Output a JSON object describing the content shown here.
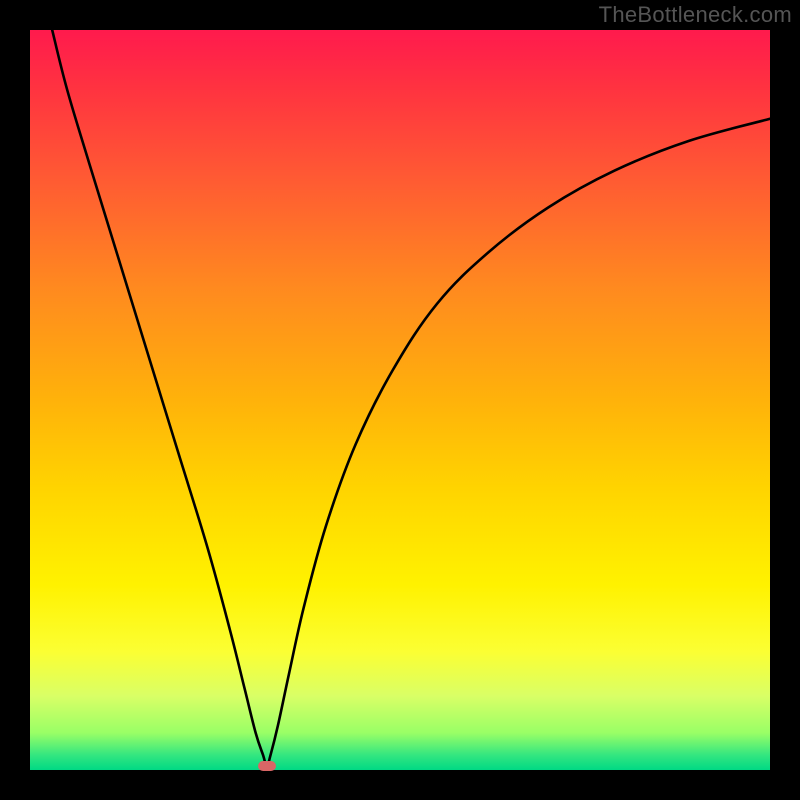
{
  "watermark": "TheBottleneck.com",
  "colors": {
    "frame": "#000000",
    "curve": "#000000",
    "marker": "#d96666"
  },
  "chart_data": {
    "type": "line",
    "title": "",
    "xlabel": "",
    "ylabel": "",
    "xlim": [
      0,
      100
    ],
    "ylim": [
      0,
      100
    ],
    "grid": false,
    "legend": false,
    "series": [
      {
        "name": "curve",
        "x": [
          3,
          5,
          8,
          12,
          16,
          20,
          24,
          27,
          29,
          30.5,
          31.5,
          32,
          32.5,
          33.5,
          35,
          37,
          40,
          44,
          49,
          55,
          62,
          70,
          79,
          89,
          100
        ],
        "y": [
          100,
          92,
          82,
          69,
          56,
          43,
          30,
          19,
          11,
          5,
          2,
          0.5,
          2,
          6,
          13,
          22,
          33,
          44,
          54,
          63,
          70,
          76,
          81,
          85,
          88
        ]
      }
    ],
    "annotations": [
      {
        "name": "bottleneck-marker",
        "x": 32,
        "y": 0.5
      }
    ],
    "background_gradient": {
      "direction": "vertical",
      "stops": [
        {
          "pos": 0.0,
          "color": "#ff1a4d"
        },
        {
          "pos": 0.5,
          "color": "#ffd400"
        },
        {
          "pos": 0.85,
          "color": "#fbff33"
        },
        {
          "pos": 1.0,
          "color": "#00d984"
        }
      ]
    }
  }
}
